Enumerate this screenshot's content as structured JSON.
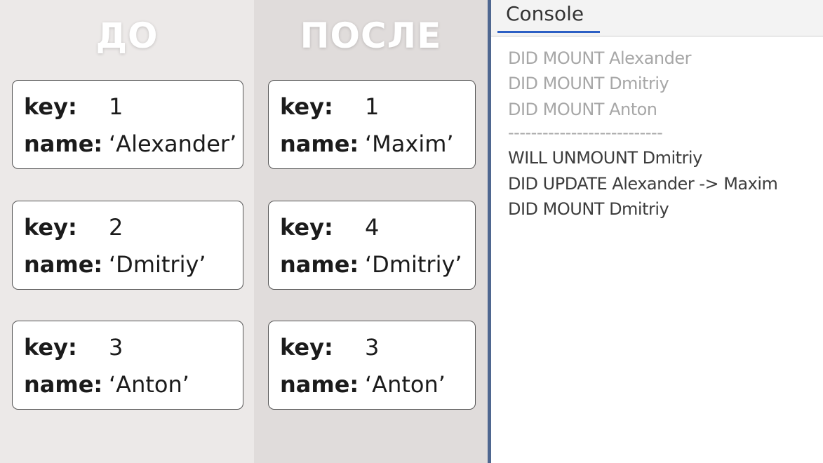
{
  "before": {
    "title": "ДО",
    "cards": [
      {
        "key_label": "key:",
        "key": "1",
        "name_label": "name:",
        "name": "‘Alexander’"
      },
      {
        "key_label": "key:",
        "key": "2",
        "name_label": "name:",
        "name": "‘Dmitriy’"
      },
      {
        "key_label": "key:",
        "key": "3",
        "name_label": "name:",
        "name": "‘Anton’"
      }
    ]
  },
  "after": {
    "title": "ПОСЛЕ",
    "cards": [
      {
        "key_label": "key:",
        "key": "1",
        "name_label": "name:",
        "name": "‘Maxim’"
      },
      {
        "key_label": "key:",
        "key": "4",
        "name_label": "name:",
        "name": "‘Dmitriy’"
      },
      {
        "key_label": "key:",
        "key": "3",
        "name_label": "name:",
        "name": "‘Anton’"
      }
    ]
  },
  "console": {
    "tab_label": "Console",
    "accent_color": "#2c5fc4",
    "lines": [
      {
        "text": "DID MOUNT  Alexander",
        "style": "old"
      },
      {
        "text": "DID MOUNT  Dmitriy",
        "style": "old"
      },
      {
        "text": "DID MOUNT  Anton",
        "style": "old"
      },
      {
        "text": "---------------------------",
        "style": "old"
      },
      {
        "text": "WILL UNMOUNT  Dmitriy",
        "style": "new"
      },
      {
        "text": "DID UPDATE  Alexander ->  Maxim",
        "style": "new"
      },
      {
        "text": "DID MOUNT  Dmitriy",
        "style": "new"
      }
    ]
  }
}
